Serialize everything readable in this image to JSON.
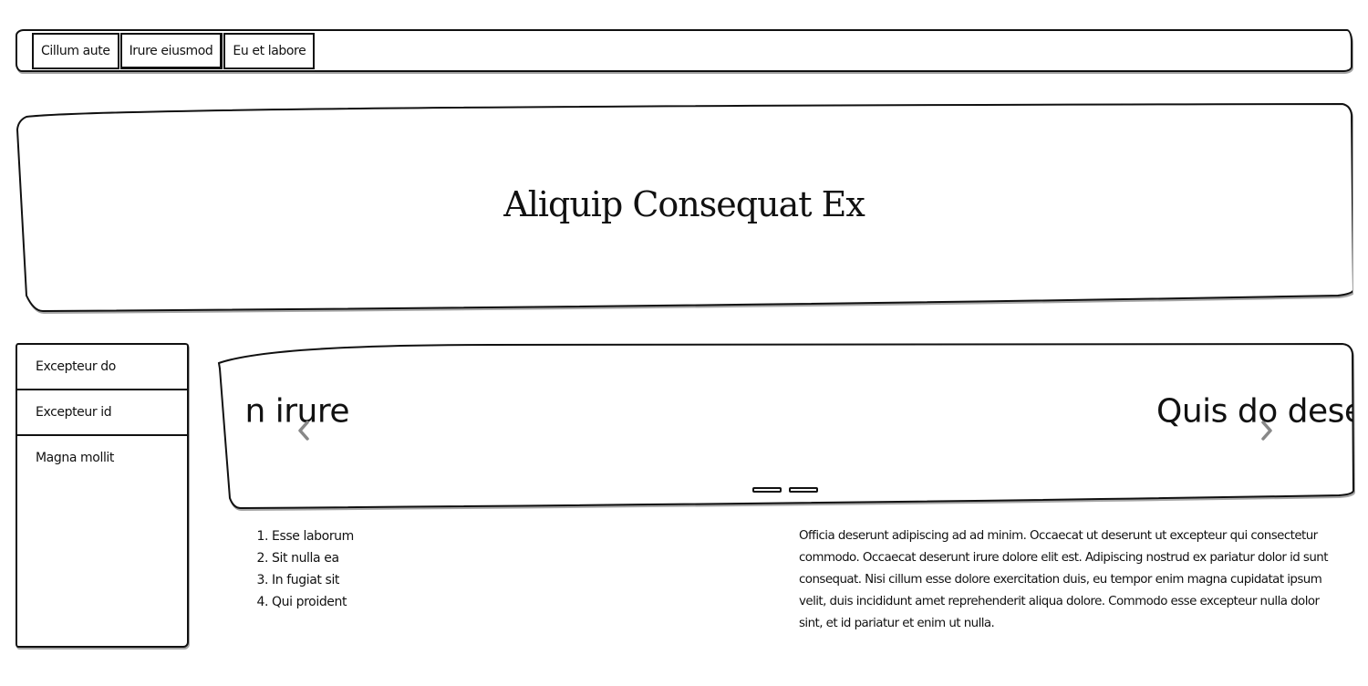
{
  "nav": {
    "tabs": [
      {
        "label": "Cillum aute"
      },
      {
        "label": "Irure eiusmod"
      },
      {
        "label": "Eu et labore"
      }
    ]
  },
  "hero": {
    "title": "Aliquip Consequat Ex"
  },
  "sidebar": {
    "items": [
      {
        "label": "Excepteur do"
      },
      {
        "label": "Excepteur id"
      },
      {
        "label": "Magna mollit"
      }
    ]
  },
  "carousel": {
    "prev_slide_text": "n irure",
    "next_slide_text": "Quis do deser",
    "prev_icon": "chevron-left-icon",
    "next_icon": "chevron-right-icon",
    "indicator_count": 2
  },
  "steps": [
    {
      "num": "1.",
      "text": "Esse laborum"
    },
    {
      "num": "2.",
      "text": "Sit nulla ea"
    },
    {
      "num": "3.",
      "text": "In fugiat sit"
    },
    {
      "num": "4.",
      "text": "Qui proident"
    }
  ],
  "body_text": "Officia deserunt adipiscing ad ad minim. Occaecat ut deserunt ut excepteur qui consectetur commodo. Occaecat deserunt irure dolore elit est. Adipiscing nostrud ex pariatur dolor id sunt consequat. Nisi cillum esse dolore exercitation duis, eu tempor enim magna cupidatat ipsum velit, duis incididunt amet reprehenderit aliqua dolore. Commodo esse excepteur nulla dolor sint, et id pariatur et enim ut nulla.",
  "colors": {
    "ink": "#111111",
    "arrow": "#888888",
    "background": "#ffffff"
  }
}
